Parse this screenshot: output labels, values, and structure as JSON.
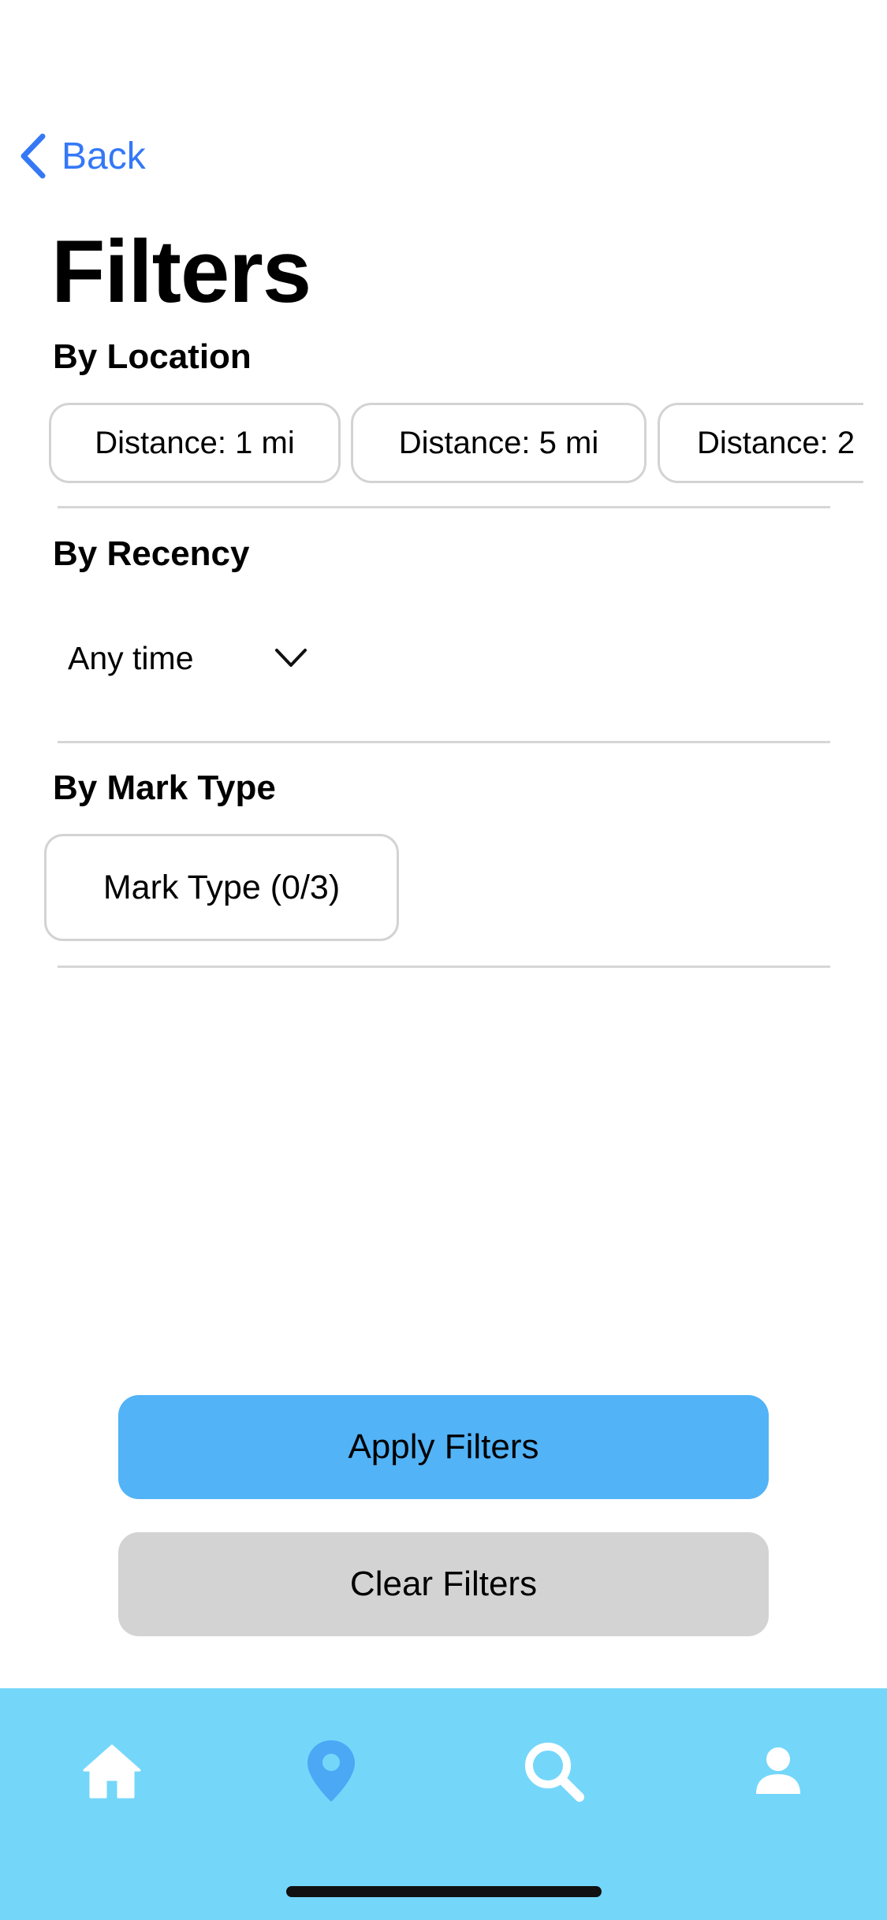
{
  "nav": {
    "back_label": "Back"
  },
  "page": {
    "title": "Filters"
  },
  "location": {
    "heading": "By Location",
    "chips": [
      "Distance: 1 mi",
      "Distance: 5 mi",
      "Distance: 2"
    ]
  },
  "recency": {
    "heading": "By Recency",
    "selected": "Any time"
  },
  "mark_type": {
    "heading": "By Mark Type",
    "button_label": "Mark Type (0/3)"
  },
  "actions": {
    "apply_label": "Apply Filters",
    "clear_label": "Clear Filters"
  },
  "tabbar": {
    "items": [
      {
        "icon": "home-icon",
        "color": "#ffffff"
      },
      {
        "icon": "map-pin-icon",
        "color": "#4aa8f5"
      },
      {
        "icon": "search-icon",
        "color": "#ffffff"
      },
      {
        "icon": "person-icon",
        "color": "#ffffff"
      }
    ]
  },
  "colors": {
    "accent": "#3478f6",
    "apply": "#52b3f7",
    "clear": "#d3d3d3",
    "tabbar": "#74d7fa"
  }
}
